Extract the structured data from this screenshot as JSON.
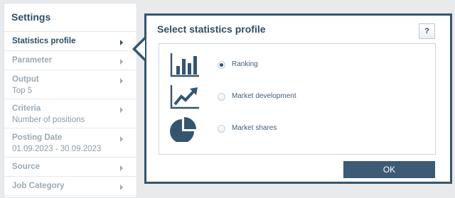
{
  "sidebar": {
    "title": "Settings",
    "items": [
      {
        "label": "Statistics profile",
        "sub": ""
      },
      {
        "label": "Parameter",
        "sub": ""
      },
      {
        "label": "Output",
        "sub": "Top 5"
      },
      {
        "label": "Criteria",
        "sub": "Number of positions"
      },
      {
        "label": "Posting Date",
        "sub": "01.09.2023 - 30.09.2023"
      },
      {
        "label": "Source",
        "sub": ""
      },
      {
        "label": "Job Category",
        "sub": ""
      }
    ]
  },
  "dialog": {
    "title": "Select statistics profile",
    "help_label": "?",
    "options": [
      {
        "label": "Ranking",
        "icon": "bar-chart-icon",
        "selected": true
      },
      {
        "label": "Market development",
        "icon": "trend-line-icon",
        "selected": false
      },
      {
        "label": "Market shares",
        "icon": "pie-chart-icon",
        "selected": false
      }
    ],
    "ok_label": "OK"
  },
  "colors": {
    "accent": "#35556f",
    "background": "#e9eaec",
    "muted_text": "#9aaab8"
  }
}
